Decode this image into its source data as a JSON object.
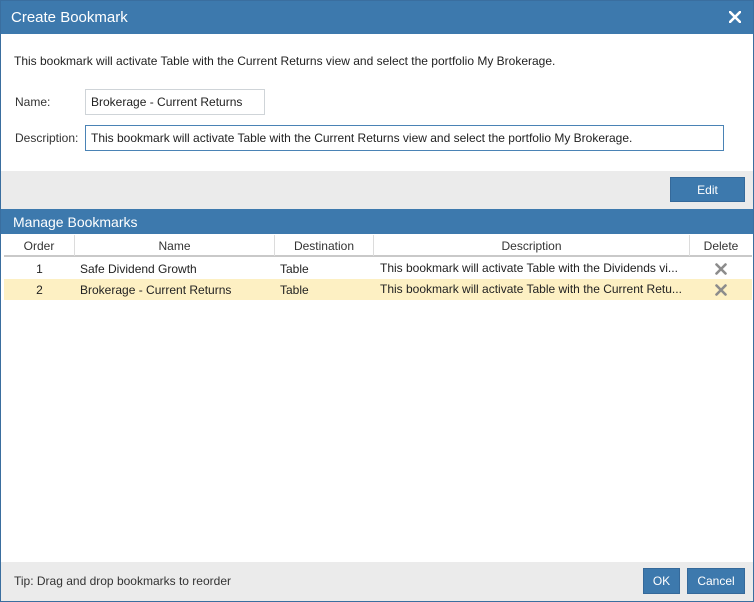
{
  "dialog": {
    "title": "Create Bookmark"
  },
  "intro": "This bookmark will activate Table with the Current Returns view and select the portfolio My Brokerage.",
  "form": {
    "name_label": "Name:",
    "name_value": "Brokerage - Current Returns",
    "description_label": "Description:",
    "description_value": "This bookmark will activate Table with the Current Returns view and select the portfolio My Brokerage."
  },
  "edit_label": "Edit",
  "manage": {
    "title": "Manage Bookmarks",
    "columns": [
      "Order",
      "Name",
      "Destination",
      "Description",
      "Delete"
    ],
    "rows": [
      {
        "order": "1",
        "name": "Safe Dividend Growth",
        "destination": "Table",
        "description": "This bookmark will activate Table with the Dividends vi...",
        "selected": false
      },
      {
        "order": "2",
        "name": "Brokerage - Current Returns",
        "destination": "Table",
        "description": "This bookmark will activate Table with the Current Retu...",
        "selected": true
      }
    ]
  },
  "footer": {
    "tip": "Tip: Drag and drop bookmarks to reorder",
    "ok_label": "OK",
    "cancel_label": "Cancel"
  },
  "colors": {
    "accent": "#3d79ad",
    "selected_row": "#fdf0c3",
    "bar_bg": "#ebebeb"
  },
  "icons": {
    "close": "close-icon",
    "delete": "x-delete-icon"
  }
}
